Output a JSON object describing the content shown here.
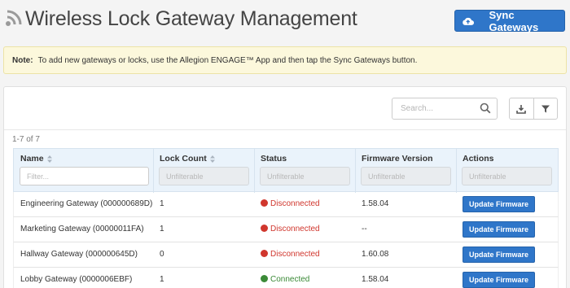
{
  "header": {
    "title": "Wireless Lock Gateway Management",
    "sync_label": "Sync Gateways"
  },
  "note": {
    "label": "Note:",
    "text": "To add new gateways or locks, use the Allegion ENGAGE™ App and then tap the Sync Gateways button."
  },
  "toolbar": {
    "search_placeholder": "Search...",
    "count": "1-7 of 7"
  },
  "table": {
    "columns": [
      {
        "label": "Name",
        "filter_placeholder": "Filter...",
        "sortable": true
      },
      {
        "label": "Lock Count",
        "filter_placeholder": "Unfilterable",
        "sortable": true
      },
      {
        "label": "Status",
        "filter_placeholder": "Unfilterable",
        "sortable": false
      },
      {
        "label": "Firmware Version",
        "filter_placeholder": "Unfilterable",
        "sortable": false
      },
      {
        "label": "Actions",
        "filter_placeholder": "Unfilterable",
        "sortable": false
      }
    ],
    "rows": [
      {
        "name": "Engineering Gateway (000000689D)",
        "lock_count": "1",
        "status": "Disconnected",
        "firmware": "1.58.04",
        "action": "Update Firmware"
      },
      {
        "name": "Marketing Gateway (00000011FA)",
        "lock_count": "1",
        "status": "Disconnected",
        "firmware": "--",
        "action": "Update Firmware"
      },
      {
        "name": "Hallway Gateway (000000645D)",
        "lock_count": "0",
        "status": "Disconnected",
        "firmware": "1.60.08",
        "action": "Update Firmware"
      },
      {
        "name": "Lobby Gateway (0000006EBF)",
        "lock_count": "1",
        "status": "Connected",
        "firmware": "1.58.04",
        "action": "Update Firmware"
      }
    ]
  },
  "colors": {
    "primary": "#2f76c9",
    "disconnected": "#d0362d",
    "connected": "#3b8a37",
    "note_bg": "#fcf8dc",
    "table_header_bg": "#eaf3fb"
  },
  "icons": {
    "logo": "signal-icon",
    "sync": "cloud-upload-icon",
    "search": "search-icon",
    "download": "download-icon",
    "filter": "filter-icon"
  }
}
